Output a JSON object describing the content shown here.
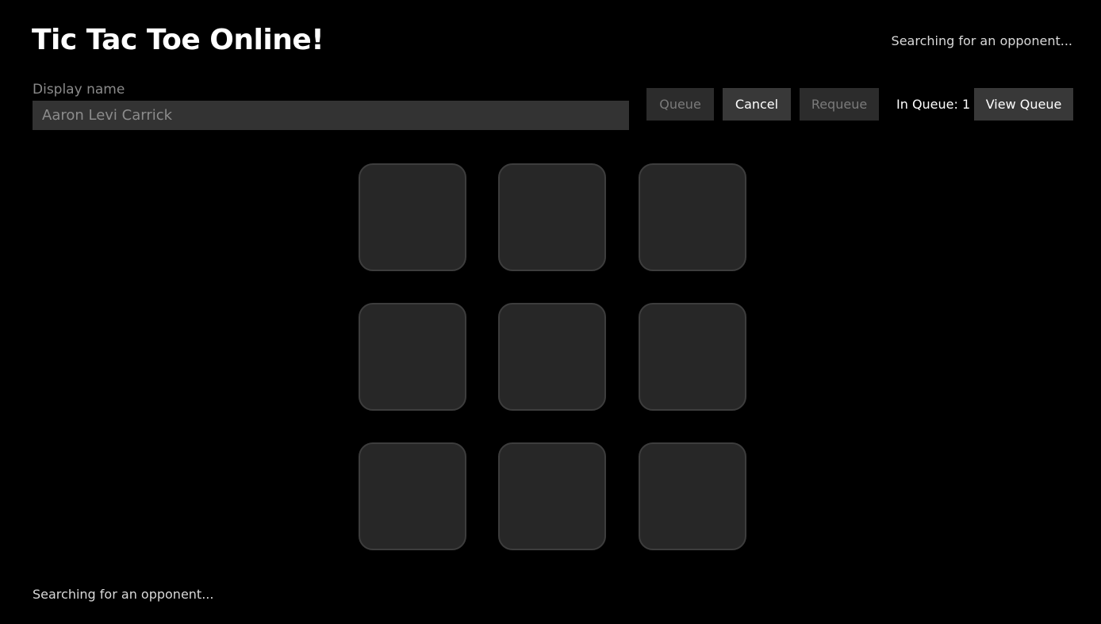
{
  "app": {
    "title": "Tic Tac Toe Online!",
    "status_top": "Searching for an opponent...",
    "status_bottom": "Searching for an opponent..."
  },
  "display_name": {
    "label": "Display name",
    "value": "Aaron Levi Carrick",
    "placeholder": ""
  },
  "toolbar": {
    "queue_label": "Queue",
    "queue_enabled": false,
    "cancel_label": "Cancel",
    "cancel_enabled": true,
    "requeue_label": "Requeue",
    "requeue_enabled": false,
    "in_queue_text": "In Queue: 1",
    "view_queue_label": "View Queue",
    "view_queue_enabled": true
  },
  "board": {
    "cells": [
      "",
      "",
      "",
      "",
      "",
      "",
      "",
      "",
      ""
    ]
  },
  "colors": {
    "background": "#000000",
    "cell_fill": "#272727",
    "cell_border": "#3d3d3d",
    "input_fill": "#333333",
    "button_enabled": "#383838",
    "button_disabled": "#2c2c2c",
    "text_primary": "#ffffff",
    "text_muted": "#8a8a8a"
  }
}
